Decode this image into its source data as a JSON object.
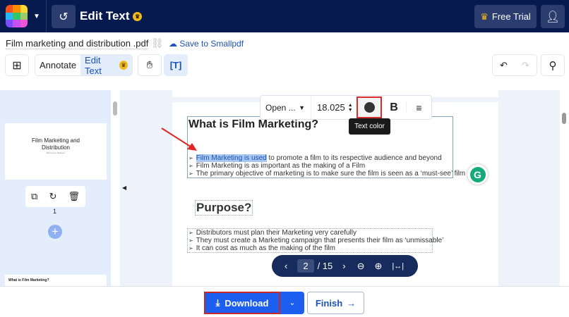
{
  "header": {
    "title": "Edit Text",
    "free_trial": "Free Trial"
  },
  "file": {
    "name": "Film marketing and distribution .pdf",
    "save_label": "Save to Smallpdf"
  },
  "toolbar": {
    "annotate": "Annotate",
    "edit_text": "Edit Text"
  },
  "format_bar": {
    "font": "Open ...",
    "size": "18.025",
    "bold": "B",
    "tooltip": "Text color"
  },
  "thumbnail": {
    "title": "Film Marketing and Distribution",
    "author": "Maimoona Nadeem",
    "page_number": "1",
    "next_title": "What is Film Marketing?"
  },
  "document": {
    "heading1": "What is Film Marketing?",
    "selected_text": "Film Marketing is used",
    "bullets1": [
      " to promote a film to its respective audience and beyond",
      "Film Marketing is as important as the making of a Film",
      "The primary objective of marketing is to make sure the film is seen as a ‘must-see’ film"
    ],
    "heading2": "Purpose?",
    "bullets2": [
      "Distributors must plan their Marketing very carefully",
      "They must create a Marketing campaign that presents their film as ‘unmissable’",
      "It can cost as much as the making of the film"
    ]
  },
  "pager": {
    "current": "2",
    "total": "/ 15"
  },
  "footer": {
    "download": "Download",
    "finish": "Finish"
  }
}
